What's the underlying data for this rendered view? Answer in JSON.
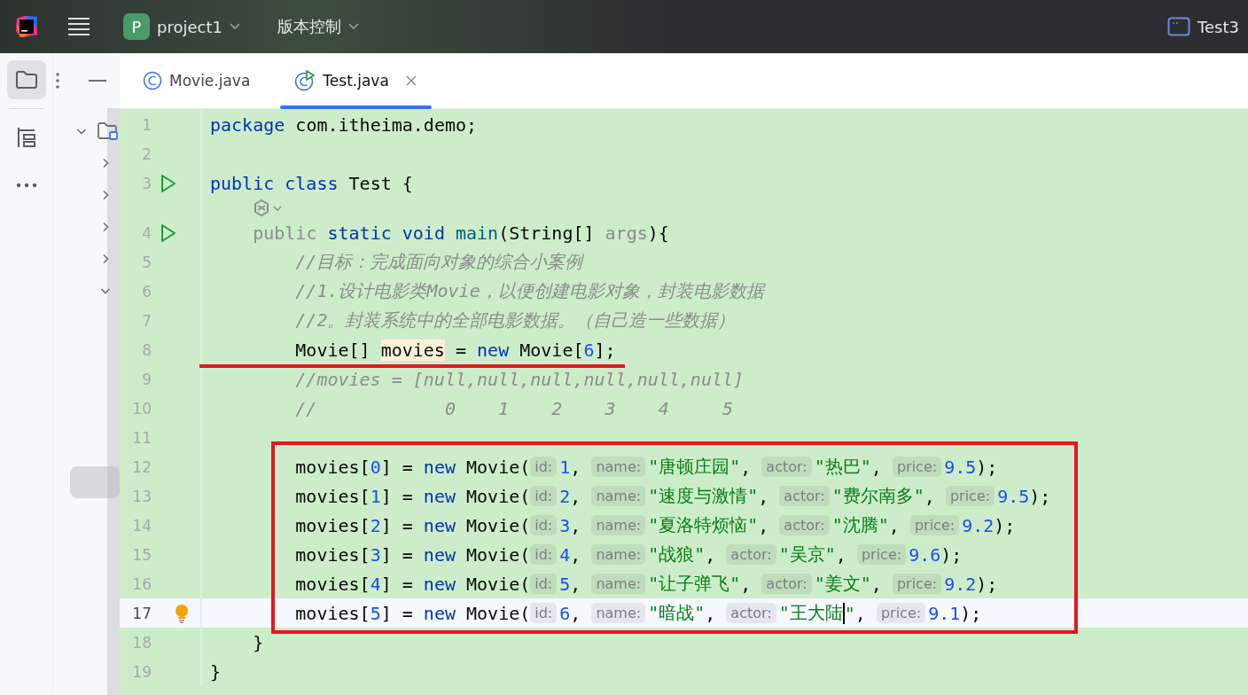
{
  "top_bar": {
    "project_avatar": "P",
    "project": "project1",
    "vcs": "版本控制",
    "run_config": "Test3"
  },
  "side_strip": [
    {
      "kind": "folder",
      "selected": true
    },
    {
      "kind": "structure",
      "selected": false
    },
    {
      "kind": "more",
      "selected": false
    }
  ],
  "tree": [
    {
      "expanded": true,
      "children": [
        {
          "expanded": false
        },
        {
          "expanded": false
        },
        {
          "expanded": false
        },
        {
          "expanded": false
        },
        {
          "expanded": true,
          "children": [
            {
              "selected": false
            },
            {
              "selected": false
            },
            {
              "selected": false
            },
            {
              "selected": false
            },
            {
              "selected": false
            },
            {
              "selected": true
            }
          ]
        }
      ]
    }
  ],
  "tabs": [
    {
      "label": "Movie.java",
      "kind": "class",
      "selected": false
    },
    {
      "label": "Test.java",
      "kind": "runnable",
      "selected": true
    }
  ],
  "rows": [
    {
      "kind": "code",
      "number": "1",
      "tokens": [
        {
          "kind": "kw",
          "text": "package"
        },
        {
          "kind": "plain",
          "text": " com.itheima.demo;"
        }
      ]
    },
    {
      "kind": "code",
      "number": "2",
      "tokens": []
    },
    {
      "kind": "code",
      "number": "3",
      "run_button": true,
      "tokens": [
        {
          "kind": "kw",
          "text": "public class"
        },
        {
          "kind": "plain",
          "text": " Test {"
        }
      ]
    },
    {
      "kind": "inlay"
    },
    {
      "kind": "code",
      "number": "4",
      "run_button": true,
      "tokens": [
        {
          "kind": "dim",
          "text": "    public"
        },
        {
          "kind": "kw",
          "text": " static void"
        },
        {
          "kind": "fn",
          "text": " main"
        },
        {
          "kind": "plain",
          "text": "(String[] "
        },
        {
          "kind": "dim",
          "text": "args"
        },
        {
          "kind": "plain",
          "text": "){"
        }
      ]
    },
    {
      "kind": "code",
      "number": "5",
      "tokens": [
        {
          "kind": "comment",
          "text": "        //目标：完成面向对象的综合小案例"
        }
      ]
    },
    {
      "kind": "code",
      "number": "6",
      "tokens": [
        {
          "kind": "comment",
          "text": "        //1.设计电影类Movie，以便创建电影对象，封装电影数据"
        }
      ]
    },
    {
      "kind": "code",
      "number": "7",
      "tokens": [
        {
          "kind": "comment",
          "text": "        //2。封装系统中的全部电影数据。（自己造一些数据）"
        }
      ]
    },
    {
      "kind": "code",
      "number": "8",
      "underlined": true,
      "tokens": [
        {
          "kind": "plain",
          "text": "        Movie[] "
        },
        {
          "kind": "highlight",
          "text": "movies"
        },
        {
          "kind": "plain",
          "text": " = "
        },
        {
          "kind": "kw",
          "text": "new"
        },
        {
          "kind": "plain",
          "text": " Movie["
        },
        {
          "kind": "num",
          "text": "6"
        },
        {
          "kind": "plain",
          "text": "];"
        }
      ]
    },
    {
      "kind": "code",
      "number": "9",
      "tokens": [
        {
          "kind": "comment",
          "text": "        //movies = [null,null,null,null,null,null]"
        }
      ]
    },
    {
      "kind": "code",
      "number": "10",
      "tokens": [
        {
          "kind": "comment",
          "text": "        //            0    1    2    3    4     5"
        }
      ]
    },
    {
      "kind": "code",
      "number": "11",
      "tokens": []
    },
    {
      "kind": "code",
      "number": "12",
      "boxed": true,
      "tokens": [
        {
          "kind": "plain",
          "text": "        movies["
        },
        {
          "kind": "num",
          "text": "0"
        },
        {
          "kind": "plain",
          "text": "] = "
        },
        {
          "kind": "kw",
          "text": "new"
        },
        {
          "kind": "plain",
          "text": " Movie("
        },
        {
          "kind": "hint",
          "text": "id:"
        },
        {
          "kind": "num",
          "text": "1"
        },
        {
          "kind": "plain",
          "text": ", "
        },
        {
          "kind": "hint",
          "text": "name:"
        },
        {
          "kind": "str",
          "text": "\"唐顿庄园\""
        },
        {
          "kind": "plain",
          "text": ", "
        },
        {
          "kind": "hint",
          "text": "actor:"
        },
        {
          "kind": "str",
          "text": "\"热巴\""
        },
        {
          "kind": "plain",
          "text": ", "
        },
        {
          "kind": "hint",
          "text": "price:"
        },
        {
          "kind": "num",
          "text": "9.5"
        },
        {
          "kind": "plain",
          "text": ");"
        }
      ]
    },
    {
      "kind": "code",
      "number": "13",
      "boxed": true,
      "tokens": [
        {
          "kind": "plain",
          "text": "        movies["
        },
        {
          "kind": "num",
          "text": "1"
        },
        {
          "kind": "plain",
          "text": "] = "
        },
        {
          "kind": "kw",
          "text": "new"
        },
        {
          "kind": "plain",
          "text": " Movie("
        },
        {
          "kind": "hint",
          "text": "id:"
        },
        {
          "kind": "num",
          "text": "2"
        },
        {
          "kind": "plain",
          "text": ", "
        },
        {
          "kind": "hint",
          "text": "name:"
        },
        {
          "kind": "str",
          "text": "\"速度与激情\""
        },
        {
          "kind": "plain",
          "text": ", "
        },
        {
          "kind": "hint",
          "text": "actor:"
        },
        {
          "kind": "str",
          "text": "\"费尔南多\""
        },
        {
          "kind": "plain",
          "text": ", "
        },
        {
          "kind": "hint",
          "text": "price:"
        },
        {
          "kind": "num",
          "text": "9.5"
        },
        {
          "kind": "plain",
          "text": ");"
        }
      ]
    },
    {
      "kind": "code",
      "number": "14",
      "boxed": true,
      "tokens": [
        {
          "kind": "plain",
          "text": "        movies["
        },
        {
          "kind": "num",
          "text": "2"
        },
        {
          "kind": "plain",
          "text": "] = "
        },
        {
          "kind": "kw",
          "text": "new"
        },
        {
          "kind": "plain",
          "text": " Movie("
        },
        {
          "kind": "hint",
          "text": "id:"
        },
        {
          "kind": "num",
          "text": "3"
        },
        {
          "kind": "plain",
          "text": ", "
        },
        {
          "kind": "hint",
          "text": "name:"
        },
        {
          "kind": "str",
          "text": "\"夏洛特烦恼\""
        },
        {
          "kind": "plain",
          "text": ", "
        },
        {
          "kind": "hint",
          "text": "actor:"
        },
        {
          "kind": "str",
          "text": "\"沈腾\""
        },
        {
          "kind": "plain",
          "text": ", "
        },
        {
          "kind": "hint",
          "text": "price:"
        },
        {
          "kind": "num",
          "text": "9.2"
        },
        {
          "kind": "plain",
          "text": ");"
        }
      ]
    },
    {
      "kind": "code",
      "number": "15",
      "boxed": true,
      "tokens": [
        {
          "kind": "plain",
          "text": "        movies["
        },
        {
          "kind": "num",
          "text": "3"
        },
        {
          "kind": "plain",
          "text": "] = "
        },
        {
          "kind": "kw",
          "text": "new"
        },
        {
          "kind": "plain",
          "text": " Movie("
        },
        {
          "kind": "hint",
          "text": "id:"
        },
        {
          "kind": "num",
          "text": "4"
        },
        {
          "kind": "plain",
          "text": ", "
        },
        {
          "kind": "hint",
          "text": "name:"
        },
        {
          "kind": "str",
          "text": "\"战狼\""
        },
        {
          "kind": "plain",
          "text": ", "
        },
        {
          "kind": "hint",
          "text": "actor:"
        },
        {
          "kind": "str",
          "text": "\"吴京\""
        },
        {
          "kind": "plain",
          "text": ", "
        },
        {
          "kind": "hint",
          "text": "price:"
        },
        {
          "kind": "num",
          "text": "9.6"
        },
        {
          "kind": "plain",
          "text": ");"
        }
      ]
    },
    {
      "kind": "code",
      "number": "16",
      "boxed": true,
      "tokens": [
        {
          "kind": "plain",
          "text": "        movies["
        },
        {
          "kind": "num",
          "text": "4"
        },
        {
          "kind": "plain",
          "text": "] = "
        },
        {
          "kind": "kw",
          "text": "new"
        },
        {
          "kind": "plain",
          "text": " Movie("
        },
        {
          "kind": "hint",
          "text": "id:"
        },
        {
          "kind": "num",
          "text": "5"
        },
        {
          "kind": "plain",
          "text": ", "
        },
        {
          "kind": "hint",
          "text": "name:"
        },
        {
          "kind": "str",
          "text": "\"让子弹飞\""
        },
        {
          "kind": "plain",
          "text": ", "
        },
        {
          "kind": "hint",
          "text": "actor:"
        },
        {
          "kind": "str",
          "text": "\"姜文\""
        },
        {
          "kind": "plain",
          "text": ", "
        },
        {
          "kind": "hint",
          "text": "price:"
        },
        {
          "kind": "num",
          "text": "9.2"
        },
        {
          "kind": "plain",
          "text": ");"
        }
      ]
    },
    {
      "kind": "code",
      "number": "17",
      "boxed": true,
      "current": true,
      "lightbulb": true,
      "tokens": [
        {
          "kind": "plain",
          "text": "        movies["
        },
        {
          "kind": "num",
          "text": "5"
        },
        {
          "kind": "plain",
          "text": "] = "
        },
        {
          "kind": "kw",
          "text": "new"
        },
        {
          "kind": "plain",
          "text": " Movie("
        },
        {
          "kind": "hint",
          "text": "id:"
        },
        {
          "kind": "num",
          "text": "6"
        },
        {
          "kind": "plain",
          "text": ", "
        },
        {
          "kind": "hint",
          "text": "name:"
        },
        {
          "kind": "str",
          "text": "\"暗战\""
        },
        {
          "kind": "plain",
          "text": ", "
        },
        {
          "kind": "hint",
          "text": "actor:"
        },
        {
          "kind": "str",
          "text": "\"王大陆"
        },
        {
          "kind": "caret"
        },
        {
          "kind": "str",
          "text": "\""
        },
        {
          "kind": "plain",
          "text": ", "
        },
        {
          "kind": "hint",
          "text": "price:"
        },
        {
          "kind": "num",
          "text": "9.1"
        },
        {
          "kind": "plain",
          "text": ");"
        }
      ]
    },
    {
      "kind": "code",
      "number": "18",
      "tokens": [
        {
          "kind": "plain",
          "text": "    }"
        }
      ]
    },
    {
      "kind": "code",
      "number": "19",
      "tokens": [
        {
          "kind": "plain",
          "text": "}"
        }
      ]
    }
  ]
}
